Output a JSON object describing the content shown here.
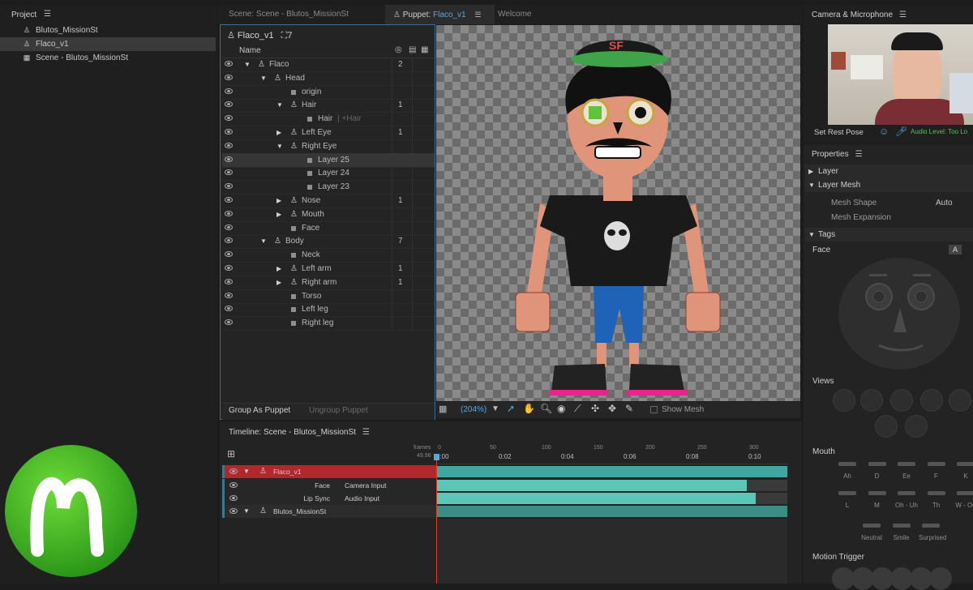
{
  "project": {
    "title": "Project",
    "items": [
      {
        "icon": "puppet-icon",
        "label": "Blutos_MissionSt",
        "selected": false
      },
      {
        "icon": "puppet-icon",
        "label": "Flaco_v1",
        "selected": true
      },
      {
        "icon": "scene-icon",
        "label": "Scene - Blutos_MissionSt",
        "selected": false
      }
    ]
  },
  "tabs": {
    "scene": "Scene: Scene - Blutos_MissionSt",
    "puppet_prefix": "Puppet:",
    "puppet_name": "Flaco_v1",
    "welcome": "Welcome"
  },
  "puppet_panel": {
    "name": "Flaco_v1",
    "handle_count": "7",
    "column_name": "Name",
    "rows": [
      {
        "depth": 0,
        "type": "puppet",
        "label": "Flaco",
        "count": "2",
        "twisty": "open"
      },
      {
        "depth": 1,
        "type": "puppet",
        "label": "Head",
        "count": "",
        "twisty": "open"
      },
      {
        "depth": 2,
        "type": "layer",
        "label": "origin",
        "count": "",
        "twisty": ""
      },
      {
        "depth": 2,
        "type": "puppet",
        "label": "Hair",
        "count": "1",
        "twisty": "open"
      },
      {
        "depth": 3,
        "type": "layer",
        "label": "Hair",
        "suffix": "| +Hair",
        "count": "",
        "twisty": ""
      },
      {
        "depth": 2,
        "type": "puppet",
        "label": "Left Eye",
        "count": "1",
        "twisty": "closed"
      },
      {
        "depth": 2,
        "type": "puppet",
        "label": "Right Eye",
        "count": "",
        "twisty": "open"
      },
      {
        "depth": 3,
        "type": "layer",
        "label": "Layer 25",
        "count": "",
        "twisty": "",
        "selected": true
      },
      {
        "depth": 3,
        "type": "layer",
        "label": "Layer 24",
        "count": "",
        "twisty": ""
      },
      {
        "depth": 3,
        "type": "layer",
        "label": "Layer 23",
        "count": "",
        "twisty": ""
      },
      {
        "depth": 2,
        "type": "puppet",
        "label": "Nose",
        "count": "1",
        "twisty": "closed"
      },
      {
        "depth": 2,
        "type": "puppet",
        "label": "Mouth",
        "count": "",
        "twisty": "closed"
      },
      {
        "depth": 2,
        "type": "layer",
        "label": "Face",
        "count": "",
        "twisty": ""
      },
      {
        "depth": 1,
        "type": "puppet",
        "label": "Body",
        "count": "7",
        "twisty": "open"
      },
      {
        "depth": 2,
        "type": "layer",
        "label": "Neck",
        "count": "",
        "twisty": ""
      },
      {
        "depth": 2,
        "type": "puppet",
        "label": "Left arm",
        "count": "1",
        "twisty": "closed"
      },
      {
        "depth": 2,
        "type": "puppet",
        "label": "Right arm",
        "count": "1",
        "twisty": "closed"
      },
      {
        "depth": 2,
        "type": "layer",
        "label": "Torso",
        "count": "",
        "twisty": ""
      },
      {
        "depth": 2,
        "type": "layer",
        "label": "Left leg",
        "count": "",
        "twisty": ""
      },
      {
        "depth": 2,
        "type": "layer",
        "label": "Right leg",
        "count": "",
        "twisty": ""
      }
    ],
    "group_button": "Group As Puppet",
    "ungroup_button": "Ungroup Puppet"
  },
  "canvas_toolbar": {
    "zoom": "(204%)",
    "show_mesh": "Show Mesh"
  },
  "camera": {
    "title": "Camera & Microphone",
    "set_rest_pose": "Set Rest Pose",
    "audio_level": "Audio Level: Too Lo"
  },
  "properties": {
    "title": "Properties",
    "layer": "Layer",
    "layer_mesh": "Layer Mesh",
    "mesh_shape_label": "Mesh Shape",
    "mesh_shape_value": "Auto",
    "mesh_expansion_label": "Mesh Expansion",
    "tags": "Tags",
    "face": "Face",
    "face_badge": "A",
    "views": "Views",
    "mouth": "Mouth",
    "mouth_shapes": [
      "Ah",
      "D",
      "Ee",
      "F",
      "K",
      "L",
      "M",
      "Oh - Uh",
      "Th",
      "W - Oo",
      "Neutral",
      "Smile",
      "Surprised"
    ],
    "motion_trigger": "Motion Trigger"
  },
  "timeline": {
    "title": "Timeline: Scene - Blutos_MissionSt",
    "frames_label": "frames",
    "time_label": "49.96",
    "frame_ticks": [
      "0",
      "50",
      "100",
      "150",
      "200",
      "250",
      "300"
    ],
    "time_ticks": [
      "0:00",
      "0:02",
      "0:04",
      "0:06",
      "0:08",
      "0:10"
    ],
    "rows": [
      {
        "label": "Flaco_v1",
        "kind": "puppet"
      },
      {
        "label": "Face",
        "input": "Camera Input",
        "kind": "behavior"
      },
      {
        "label": "Lip Sync",
        "input": "Audio Input",
        "kind": "behavior"
      },
      {
        "label": "Blutos_MissionSt",
        "kind": "puppet"
      }
    ]
  },
  "colors": {
    "accent_blue": "#4fa9e6",
    "track_teal": "#4ec4b2",
    "selected_red": "#b0272d",
    "playhead": "#e23a2c"
  }
}
